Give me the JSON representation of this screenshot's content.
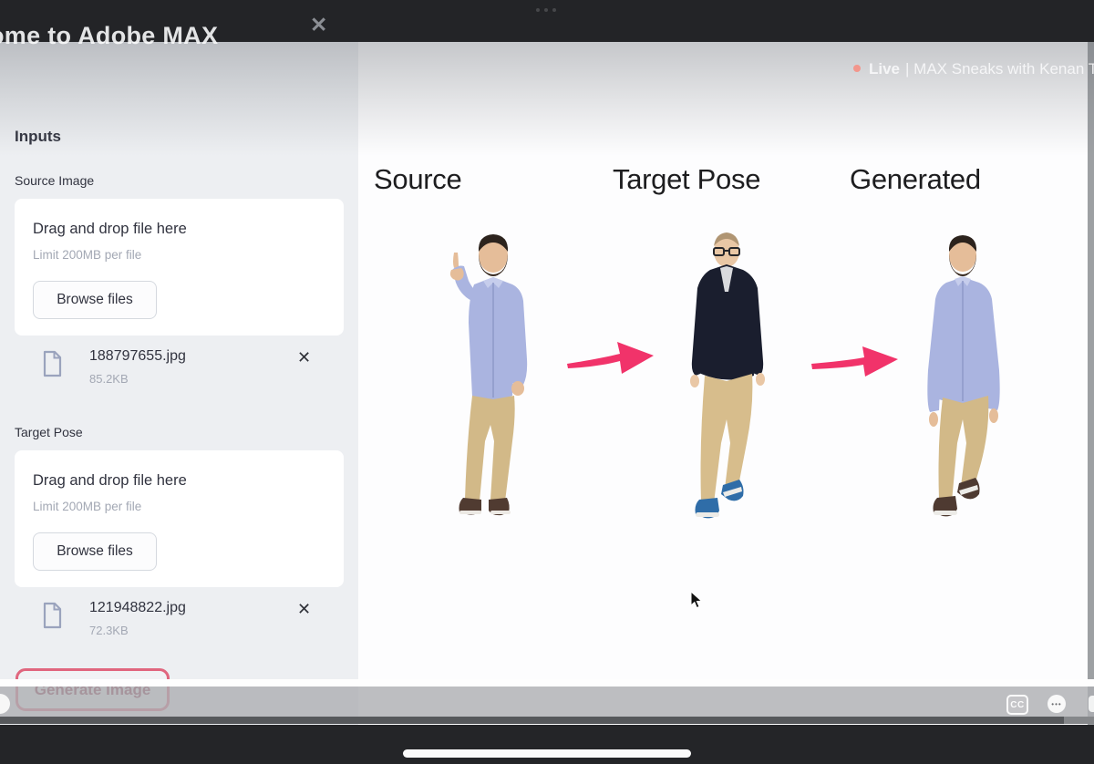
{
  "app": {
    "welcome_title": "ome to Adobe MAX"
  },
  "icons": {
    "close": "✕",
    "remove_file": "✕",
    "ellipsis": "•••"
  },
  "sidebar": {
    "inputs_heading": "Inputs",
    "sections": [
      {
        "label": "Source Image",
        "dropzone_title": "Drag and drop file here",
        "dropzone_limit": "Limit 200MB per file",
        "browse_label": "Browse files",
        "file": {
          "name": "188797655.jpg",
          "size": "85.2KB"
        }
      },
      {
        "label": "Target Pose",
        "dropzone_title": "Drag and drop file here",
        "dropzone_limit": "Limit 200MB per file",
        "browse_label": "Browse files",
        "file": {
          "name": "121948822.jpg",
          "size": "72.3KB"
        }
      }
    ],
    "generate_button_label": "Generate Image"
  },
  "main": {
    "live_label_bold": "Live",
    "live_label_rest": "| MAX Sneaks with Kenan Tho",
    "column_headings": [
      "Source",
      "Target Pose",
      "Generated"
    ]
  },
  "player": {
    "cc_label": "CC"
  },
  "colors": {
    "accent_pink": "#f1336a",
    "highlight_ring": "#e0667e",
    "live_dot": "#f2968c",
    "shirt_blue": "#aab4e0",
    "khaki": "#d2b988",
    "cardigan_navy": "#1a1e2e",
    "sidebar_bg": "#edeff2"
  }
}
